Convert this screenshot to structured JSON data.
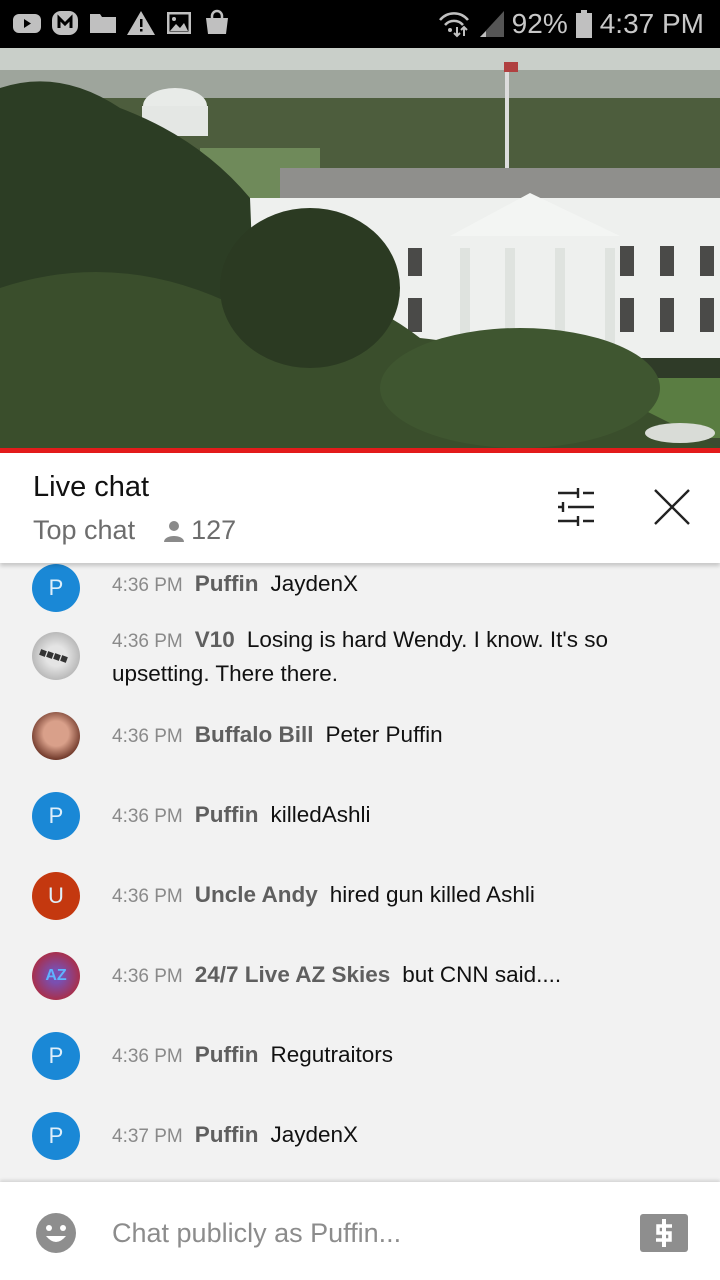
{
  "status_bar": {
    "notification_icons": [
      "youtube-icon",
      "messenger-icon",
      "folder-icon",
      "warning-icon",
      "image-icon",
      "shopping-bag-icon"
    ],
    "battery": "92%",
    "time": "4:37 PM"
  },
  "video": {
    "description": "White House live camera view"
  },
  "chat_header": {
    "title": "Live chat",
    "mode": "Top chat",
    "viewer_count": "127"
  },
  "messages": [
    {
      "time": "4:36 PM",
      "author": "Puffin",
      "text": "JaydenX",
      "avatar_letter": "P",
      "avatar_color": "#1a88d6"
    },
    {
      "time": "4:36 PM",
      "author": "V10",
      "text": "Losing is hard Wendy. I know. It's so upsetting. There there.",
      "avatar_letter": "",
      "avatar_color": "#b8b8b8"
    },
    {
      "time": "4:36 PM",
      "author": "Buffalo Bill",
      "text": "Peter Puffin",
      "avatar_letter": "",
      "avatar_color": "#8a4a3a"
    },
    {
      "time": "4:36 PM",
      "author": "Puffin",
      "text": "killedAshli",
      "avatar_letter": "P",
      "avatar_color": "#1a88d6"
    },
    {
      "time": "4:36 PM",
      "author": "Uncle Andy",
      "text": "hired gun killed Ashli",
      "avatar_letter": "U",
      "avatar_color": "#c4380f"
    },
    {
      "time": "4:36 PM",
      "author": "24/7 Live AZ Skies",
      "text": "but CNN said....",
      "avatar_letter": "AZ",
      "avatar_color": "#8a2d4a"
    },
    {
      "time": "4:36 PM",
      "author": "Puffin",
      "text": "Regutraitors",
      "avatar_letter": "P",
      "avatar_color": "#1a88d6"
    },
    {
      "time": "4:37 PM",
      "author": "Puffin",
      "text": "JaydenX",
      "avatar_letter": "P",
      "avatar_color": "#1a88d6"
    }
  ],
  "composer": {
    "placeholder": "Chat publicly as Puffin...",
    "value": ""
  },
  "colors": {
    "progress": "#e31b1b",
    "avatar_blue": "#1a88d6"
  }
}
